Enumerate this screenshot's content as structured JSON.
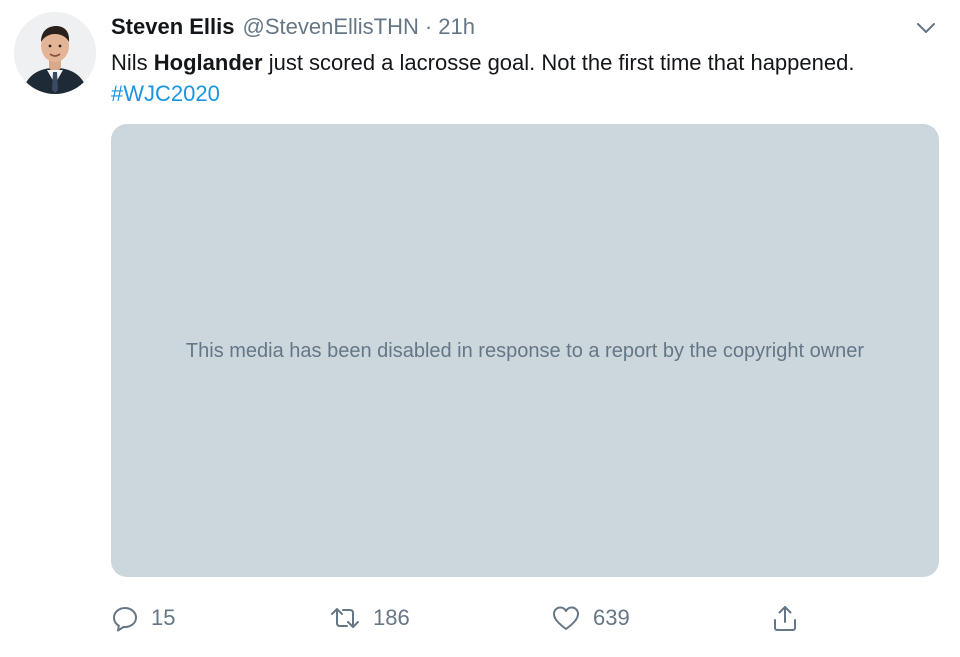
{
  "tweet": {
    "author_name": "Steven Ellis",
    "author_handle": "@StevenEllisTHN",
    "separator": "·",
    "timestamp": "21h",
    "text_part1": "Nils ",
    "text_bold": "Hoglander",
    "text_part2": " just scored a lacrosse goal. Not the first time that happened. ",
    "hashtag": "#WJC2020",
    "media_message": "This media has been disabled in response to a report by the copyright owner"
  },
  "actions": {
    "reply_count": "15",
    "retweet_count": "186",
    "like_count": "639"
  },
  "icons": {
    "caret": "chevron-down-icon",
    "reply": "reply-icon",
    "retweet": "retweet-icon",
    "like": "heart-icon",
    "share": "share-icon"
  },
  "colors": {
    "link": "#1b95e0",
    "secondary_text": "#657786",
    "media_background": "#ccd6dd"
  }
}
